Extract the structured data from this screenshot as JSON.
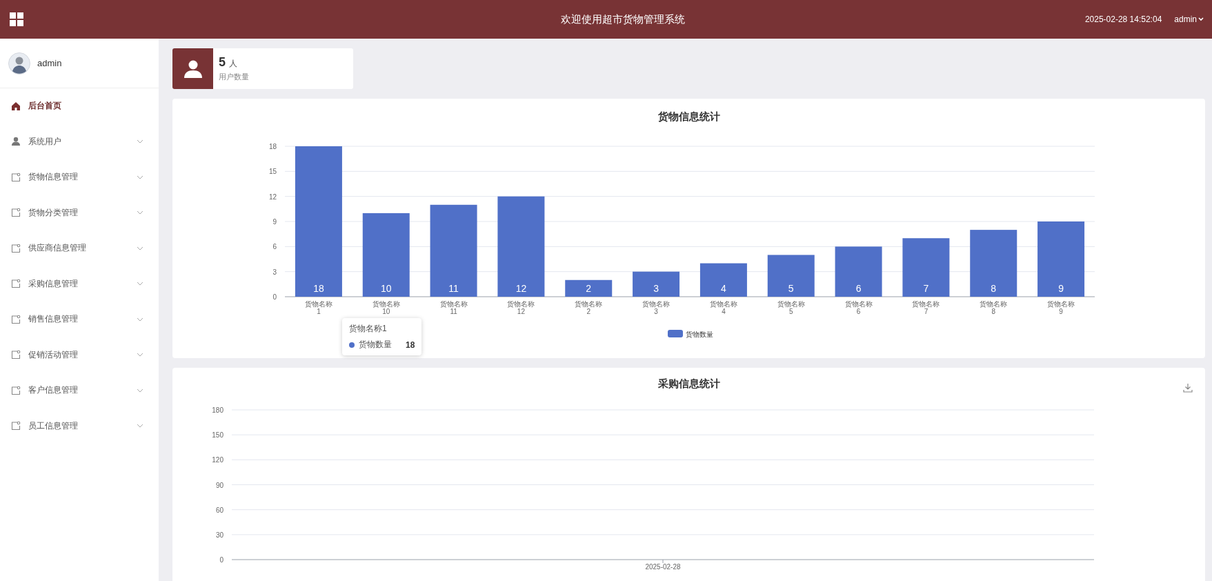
{
  "header": {
    "title": "欢迎使用超市货物管理系统",
    "datetime": "2025-02-28 14:52:04",
    "user": "admin"
  },
  "sidebar": {
    "user": "admin",
    "items": [
      {
        "label": "后台首页",
        "kind": "home",
        "selected": true
      },
      {
        "label": "系统用户",
        "kind": "user",
        "selected": false
      },
      {
        "label": "货物信息管理",
        "kind": "module",
        "selected": false
      },
      {
        "label": "货物分类管理",
        "kind": "module",
        "selected": false
      },
      {
        "label": "供应商信息管理",
        "kind": "module",
        "selected": false
      },
      {
        "label": "采购信息管理",
        "kind": "module",
        "selected": false
      },
      {
        "label": "销售信息管理",
        "kind": "module",
        "selected": false
      },
      {
        "label": "促销活动管理",
        "kind": "module",
        "selected": false
      },
      {
        "label": "客户信息管理",
        "kind": "module",
        "selected": false
      },
      {
        "label": "员工信息管理",
        "kind": "module",
        "selected": false
      }
    ]
  },
  "stat_card": {
    "value": "5",
    "unit": "人",
    "label": "用户数量"
  },
  "goods_chart": {
    "tooltip": {
      "title": "货物名称1",
      "series": "货物数量",
      "value": "18"
    },
    "chart_data": {
      "type": "bar",
      "title": "货物信息统计",
      "categories": [
        "货物名称1",
        "货物名称10",
        "货物名称11",
        "货物名称12",
        "货物名称2",
        "货物名称3",
        "货物名称4",
        "货物名称5",
        "货物名称6",
        "货物名称7",
        "货物名称8",
        "货物名称9"
      ],
      "series": [
        {
          "name": "货物数量",
          "color": "#5070c8",
          "values": [
            18,
            10,
            11,
            12,
            2,
            3,
            4,
            5,
            6,
            7,
            8,
            9
          ]
        }
      ],
      "ylim": [
        0,
        18
      ],
      "yticks": [
        0,
        3,
        6,
        9,
        12,
        15,
        18
      ],
      "grid": true,
      "data_labels": true
    }
  },
  "purchase_chart": {
    "chart_data": {
      "type": "bar",
      "title": "采购信息统计",
      "categories": [
        "2025-02-28"
      ],
      "series": [
        {
          "values": [
            0
          ]
        }
      ],
      "ylim": [
        0,
        180
      ],
      "yticks": [
        0,
        30,
        60,
        90,
        120,
        150,
        180
      ],
      "grid": true
    }
  }
}
